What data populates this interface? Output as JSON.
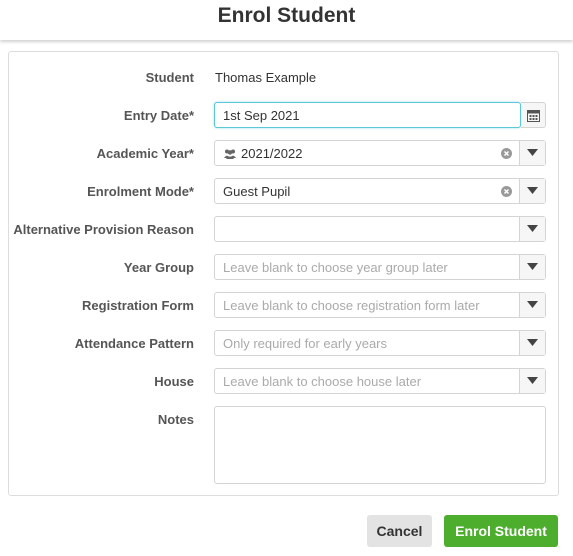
{
  "header": {
    "title": "Enrol Student"
  },
  "form": {
    "student": {
      "label": "Student",
      "value": "Thomas Example"
    },
    "entry_date": {
      "label": "Entry Date*",
      "value": "1st Sep 2021",
      "icon": "calendar-icon"
    },
    "academic_year": {
      "label": "Academic Year*",
      "value": "2021/2022",
      "icon": "users-icon"
    },
    "enrolment_mode": {
      "label": "Enrolment Mode*",
      "value": "Guest Pupil"
    },
    "alternative_provision": {
      "label": "Alternative Provision Reason",
      "value": ""
    },
    "year_group": {
      "label": "Year Group",
      "placeholder": "Leave blank to choose year group later"
    },
    "registration_form": {
      "label": "Registration Form",
      "placeholder": "Leave blank to choose registration form later"
    },
    "attendance_pattern": {
      "label": "Attendance Pattern",
      "placeholder": "Only required for early years"
    },
    "house": {
      "label": "House",
      "placeholder": "Leave blank to choose house later"
    },
    "notes": {
      "label": "Notes",
      "value": ""
    }
  },
  "buttons": {
    "cancel": "Cancel",
    "enrol": "Enrol Student"
  },
  "colors": {
    "accent_focus": "#5ac8d8",
    "primary_button": "#4cae2c",
    "secondary_button": "#e3e3e3"
  }
}
